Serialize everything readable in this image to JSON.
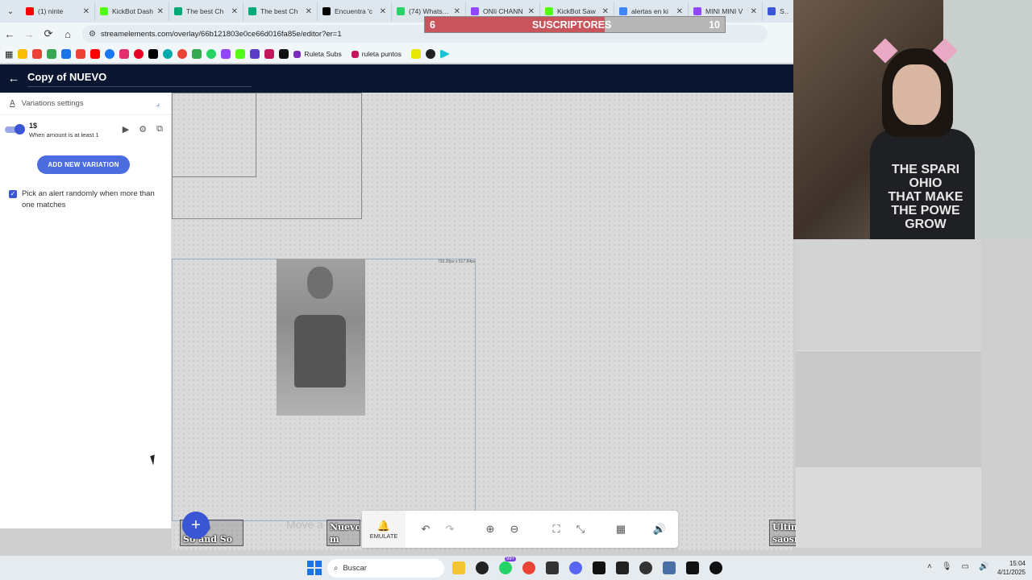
{
  "browser": {
    "tabs": [
      {
        "title": "(1) ninte",
        "color": "#ff0000"
      },
      {
        "title": "KickBot Dash",
        "color": "#53fc18"
      },
      {
        "title": "The best Ch",
        "color": "#0a7"
      },
      {
        "title": "The best Ch",
        "color": "#0a7"
      },
      {
        "title": "Encuentra 'c",
        "color": "#000000"
      },
      {
        "title": "(74) WhatsAp",
        "color": "#25d366"
      },
      {
        "title": "ONIi CHANN",
        "color": "#9146ff"
      },
      {
        "title": "KickBot Saw",
        "color": "#53fc18"
      },
      {
        "title": "alertas en ki",
        "color": "#4285f4"
      },
      {
        "title": "MINI MINI V",
        "color": "#9146ff"
      },
      {
        "title": "Stre",
        "color": "#3a56d4"
      }
    ],
    "url": "streamelements.com/overlay/66b121803e0ce66d016fa85e/editor?er=1",
    "bookmarks": [
      {
        "label": "Ruleta Subs",
        "color": "#7b2cbf"
      },
      {
        "label": "ruleta puntos",
        "color": "#c2185b"
      }
    ]
  },
  "sub_goal": {
    "current": "6",
    "title": "SUSCRIPTORES",
    "target": "10",
    "fill_fraction": 0.6,
    "fill_color": "#c8545c"
  },
  "editor": {
    "title": "Copy of NUEVO",
    "sidebar": {
      "header": "Variations settings",
      "variation_amount": "1$",
      "variation_condition": "When amount is at least 1",
      "add_variation_label": "ADD NEW VARIATION",
      "pick_random_label": "Pick an alert randomly when more than one matches",
      "pick_random_checked": true
    },
    "canvas": {
      "move_hint": "Move a",
      "size_tag": "733.20px x 517.84px",
      "bottom_labels": [
        {
          "text": "o sub\nSo and So"
        },
        {
          "text": "Nuevo\nm"
        },
        {
          "text": "Último host:\nsaosmyth"
        }
      ]
    },
    "toolbar": {
      "emulate_label": "EMULATE"
    }
  },
  "webcam": {
    "shirt_text": "THE SPARI\nOHIO\nTHAT MAKE\nTHE POWE\nGROW"
  },
  "taskbar": {
    "search_placeholder": "Buscar",
    "time": "15:04",
    "date": "4/11/2025",
    "badge": "99+"
  },
  "colors": {
    "accent": "#3a56d4",
    "header_bg": "#0b1630"
  }
}
